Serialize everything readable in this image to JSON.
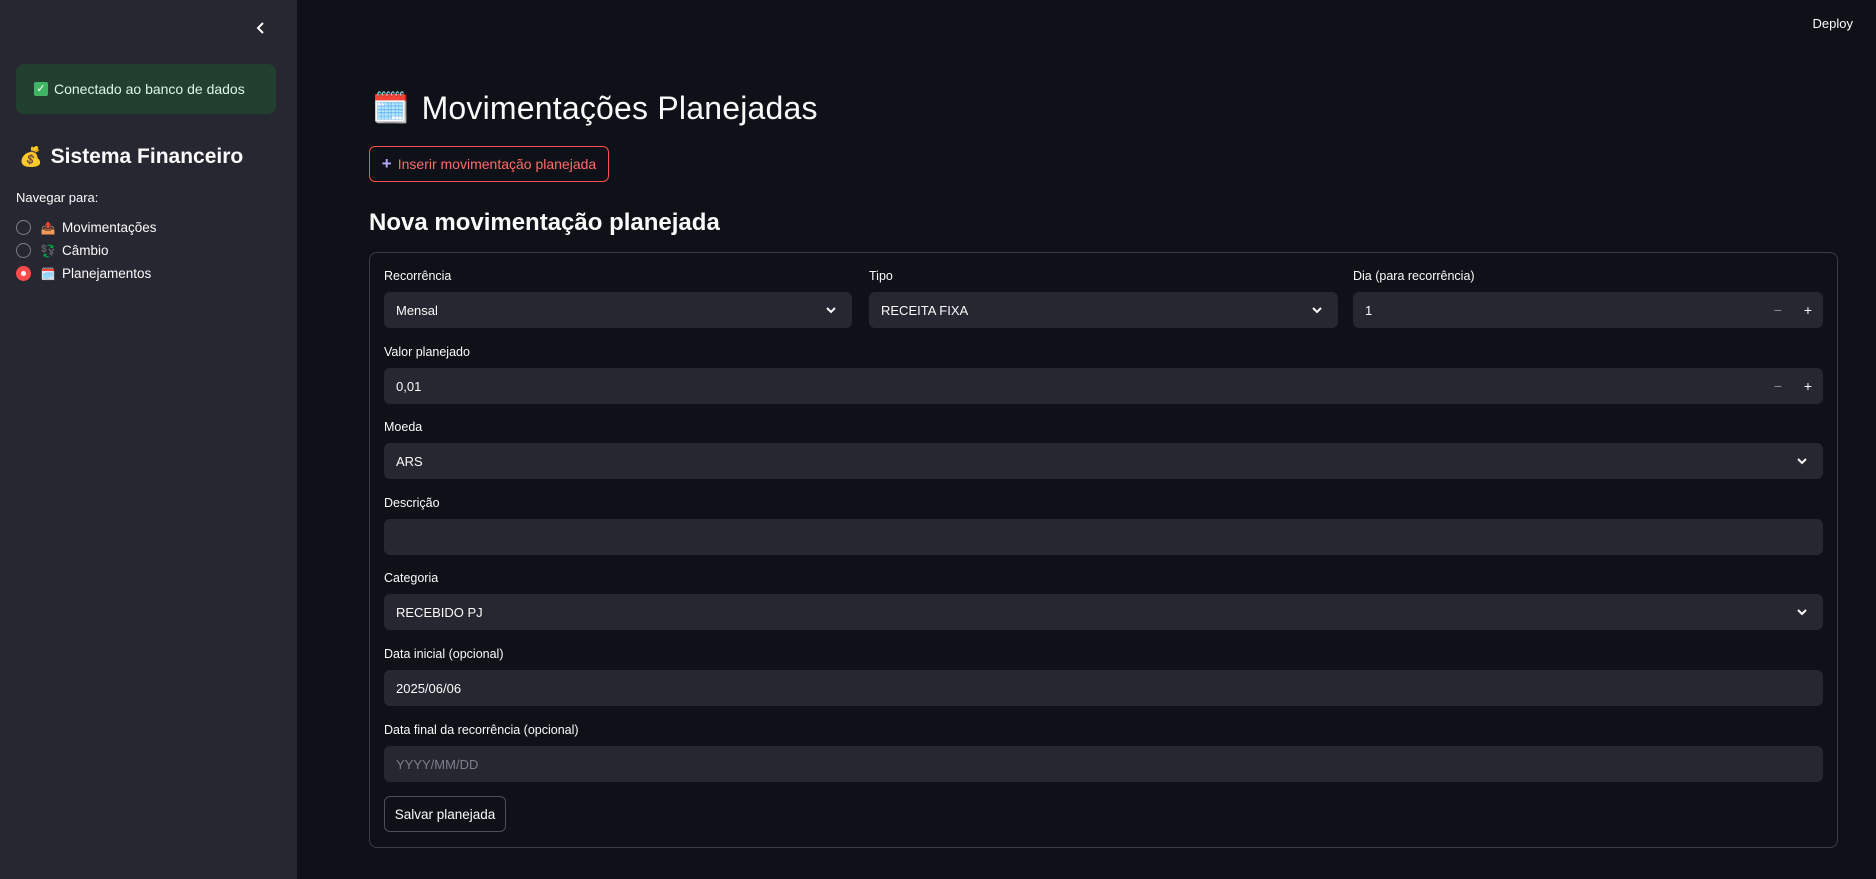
{
  "sidebar": {
    "collapse_icon": "chevron-left-icon",
    "alert_text": "Conectado ao banco de dados",
    "title_emoji": "💰",
    "title": "Sistema Financeiro",
    "nav_label": "Navegar para:",
    "items": [
      {
        "emoji": "📤",
        "label": "Movimentações",
        "selected": false
      },
      {
        "emoji": "💱",
        "label": "Câmbio",
        "selected": false
      },
      {
        "emoji": "🗓️",
        "label": "Planejamentos",
        "selected": true
      }
    ]
  },
  "header": {
    "deploy_label": "Deploy"
  },
  "main": {
    "title_emoji": "🗓️",
    "title": "Movimentações Planejadas",
    "insert_button": "Inserir movimentação planejada",
    "section_title": "Nova movimentação planejada",
    "form": {
      "recorrencia": {
        "label": "Recorrência",
        "value": "Mensal"
      },
      "tipo": {
        "label": "Tipo",
        "value": "RECEITA FIXA"
      },
      "dia": {
        "label": "Dia (para recorrência)",
        "value": "1"
      },
      "valor": {
        "label": "Valor planejado",
        "value": "0,01"
      },
      "moeda": {
        "label": "Moeda",
        "value": "ARS"
      },
      "descricao": {
        "label": "Descrição",
        "value": ""
      },
      "categoria": {
        "label": "Categoria",
        "value": "RECEBIDO PJ"
      },
      "data_inicial": {
        "label": "Data inicial (opcional)",
        "value": "2025/06/06"
      },
      "data_final": {
        "label": "Data final da recorrência (opcional)",
        "placeholder": "YYYY/MM/DD"
      },
      "save_button": "Salvar planejada",
      "stepper_minus": "−",
      "stepper_plus": "+"
    }
  },
  "colors": {
    "accent": "#ff4b4b",
    "background": "#0e1117",
    "sidebar": "#262730",
    "success_bg": "#21402f"
  }
}
